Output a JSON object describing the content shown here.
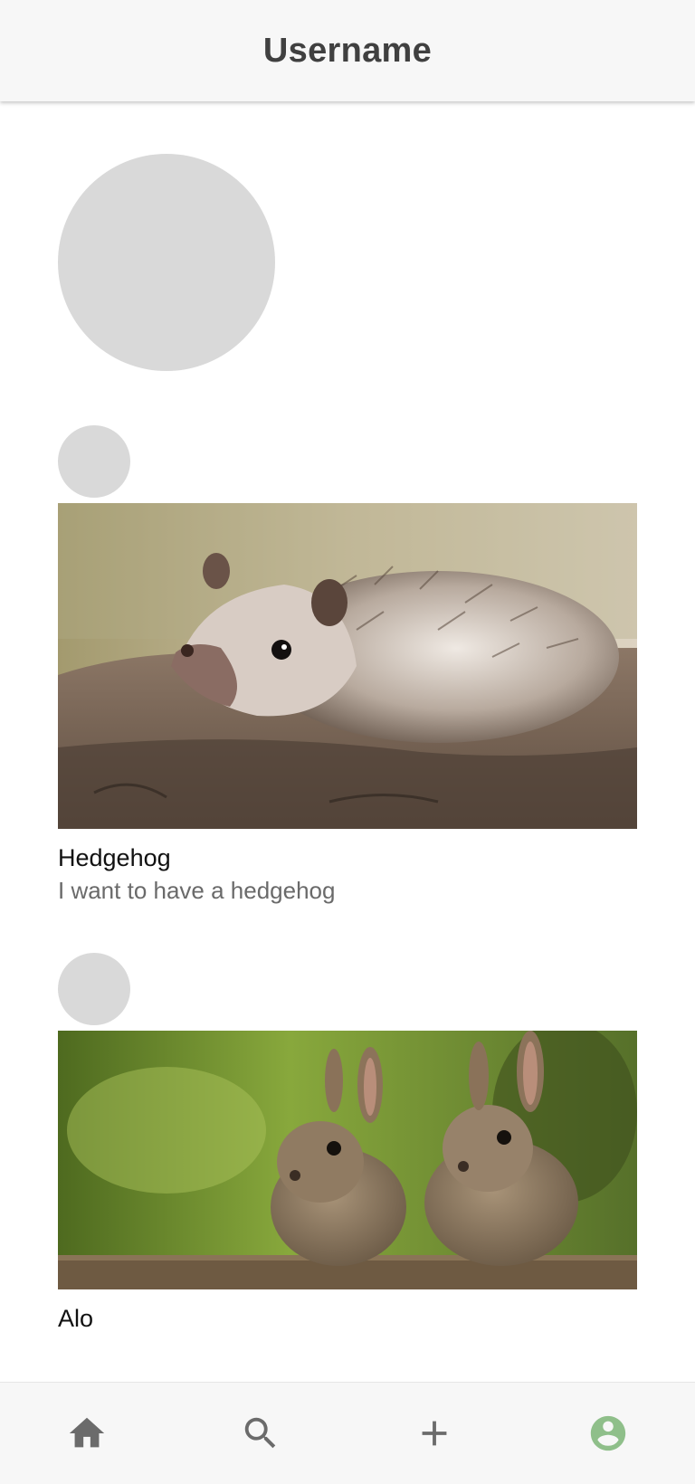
{
  "header": {
    "title": "Username"
  },
  "profile": {
    "avatar_color": "#d9d9d9"
  },
  "posts": [
    {
      "title": "Hedgehog",
      "description": "I want to have a hedgehog",
      "image_icon": "hedgehog-photo"
    },
    {
      "title": "Alo",
      "description": "",
      "image_icon": "rabbits-photo"
    }
  ],
  "bottom_nav": {
    "items": [
      {
        "icon": "home-icon",
        "active": false
      },
      {
        "icon": "search-icon",
        "active": false
      },
      {
        "icon": "add-icon",
        "active": false
      },
      {
        "icon": "account-icon",
        "active": true
      }
    ],
    "inactive_color": "#6b6b6b",
    "active_color": "#8fbf8a"
  }
}
